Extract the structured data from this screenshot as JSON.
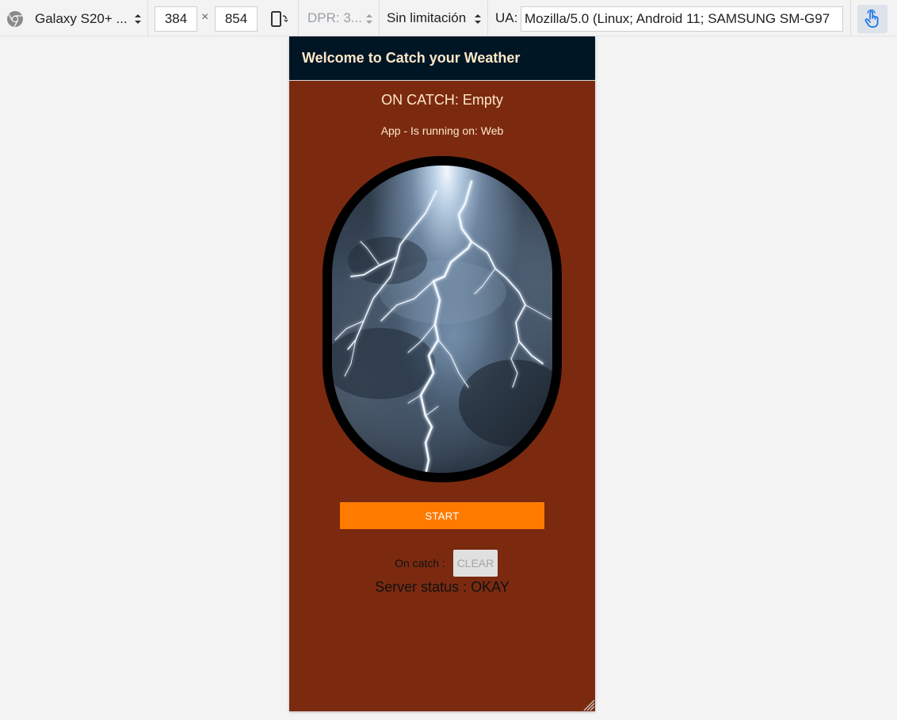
{
  "devtools": {
    "device_name": "Galaxy S20+ ...",
    "width": "384",
    "times": "×",
    "height": "854",
    "dpr": "DPR: 3...",
    "throttling": "Sin limitación",
    "ua_label": "UA:",
    "user_agent": "Mozilla/5.0 (Linux; Android 11; SAMSUNG SM-G97",
    "accent": "#1a73e8"
  },
  "app": {
    "header_title": "Welcome to Catch your Weather",
    "catch_status": "ON CATCH: Empty",
    "running_on": "App - Is running on:  Web",
    "start_label": "START",
    "on_catch_label": "On catch :",
    "clear_label": "CLEAR",
    "server_status": "Server status : OKAY",
    "colors": {
      "background": "#7b2a10",
      "header": "#011625",
      "start_button": "#ff7b00",
      "text": "#fde8c7"
    },
    "image": "lightning-storm-image"
  }
}
